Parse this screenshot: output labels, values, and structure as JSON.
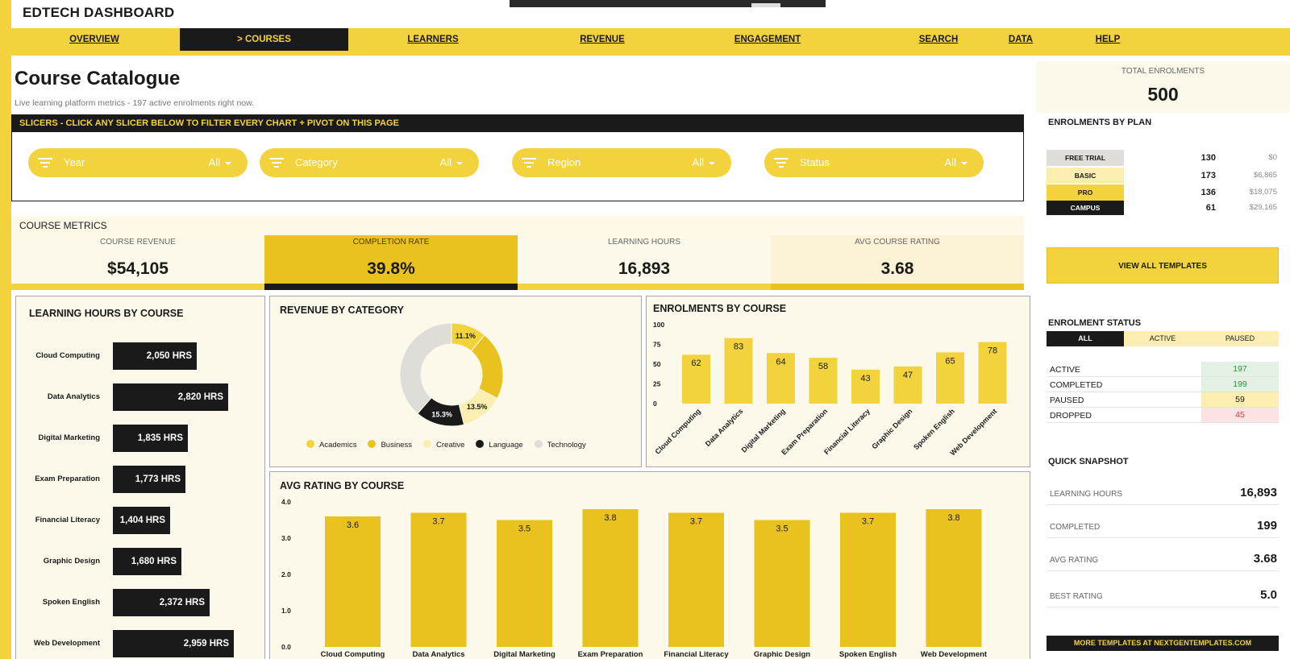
{
  "app": {
    "title": "EDTECH DASHBOARD"
  },
  "nav": {
    "items": [
      {
        "label": "OVERVIEW"
      },
      {
        "label": "> COURSES"
      },
      {
        "label": "LEARNERS"
      },
      {
        "label": "REVENUE"
      },
      {
        "label": "ENGAGEMENT"
      },
      {
        "label": "SEARCH"
      },
      {
        "label": "DATA"
      },
      {
        "label": "HELP"
      }
    ],
    "active_index": 1
  },
  "page": {
    "title": "Course Catalogue",
    "subtitle": "Live learning platform metrics  -  197 active enrolments right now."
  },
  "slicers": {
    "header": "SLICERS  -  CLICK ANY SLICER BELOW TO FILTER EVERY CHART + PIVOT ON THIS PAGE",
    "items": [
      {
        "label": "Year",
        "value": "All"
      },
      {
        "label": "Category",
        "value": "All"
      },
      {
        "label": "Region",
        "value": "All"
      },
      {
        "label": "Status",
        "value": "All"
      }
    ]
  },
  "metrics": {
    "header": "COURSE METRICS",
    "cards": [
      {
        "label": "COURSE REVENUE",
        "value": "$54,105"
      },
      {
        "label": "COMPLETION RATE",
        "value": "39.8%"
      },
      {
        "label": "LEARNING HOURS",
        "value": "16,893"
      },
      {
        "label": "AVG COURSE RATING",
        "value": "3.68"
      }
    ]
  },
  "colors": {
    "accent": "#f2d33e",
    "accent_dark": "#e9c21f",
    "dark": "#1a1a1a",
    "panel": "#fdf9ea",
    "pale": "#fbeeb0",
    "grey": "#deddd8"
  },
  "chart_data": [
    {
      "type": "bar",
      "orientation": "horizontal",
      "title": "LEARNING HOURS BY COURSE",
      "categories": [
        "Cloud Computing",
        "Data Analytics",
        "Digital Marketing",
        "Exam Preparation",
        "Financial Literacy",
        "Graphic Design",
        "Spoken English",
        "Web Development"
      ],
      "values": [
        2050,
        2820,
        1835,
        1773,
        1404,
        1680,
        2372,
        2959
      ],
      "labels": [
        "2,050 HRS",
        "2,820 HRS",
        "1,835 HRS",
        "1,773 HRS",
        "1,404 HRS",
        "1,680 HRS",
        "2,372 HRS",
        "2,959 HRS"
      ]
    },
    {
      "type": "pie",
      "title": "REVENUE BY CATEGORY",
      "categories": [
        "Academics",
        "Business",
        "Creative",
        "Language",
        "Technology"
      ],
      "values": [
        11.1,
        21.5,
        13.5,
        15.3,
        38.6
      ],
      "labels": [
        "11.1%",
        "",
        "13.5%",
        "15.3%",
        ""
      ],
      "colors": [
        "#f2d33e",
        "#e9c21f",
        "#fbeeb0",
        "#1a1a1a",
        "#deddd8"
      ]
    },
    {
      "type": "bar",
      "title": "ENROLMENTS BY COURSE",
      "categories": [
        "Cloud Computing",
        "Data Analytics",
        "Digital Marketing",
        "Exam Preparation",
        "Financial Literacy",
        "Graphic Design",
        "Spoken English",
        "Web Development"
      ],
      "values": [
        62,
        83,
        64,
        58,
        43,
        47,
        65,
        78
      ],
      "ylim": [
        0,
        100
      ],
      "yticks": [
        "0",
        "25",
        "50",
        "75",
        "100"
      ]
    },
    {
      "type": "bar",
      "title": "AVG RATING BY COURSE",
      "categories": [
        "Cloud Computing",
        "Data Analytics",
        "Digital Marketing",
        "Exam Preparation",
        "Financial Literacy",
        "Graphic Design",
        "Spoken English",
        "Web Development"
      ],
      "values": [
        3.6,
        3.7,
        3.5,
        3.8,
        3.7,
        3.5,
        3.7,
        3.8
      ],
      "ylim": [
        0,
        4
      ],
      "yticks": [
        "0.0",
        "1.0",
        "2.0",
        "3.0",
        "4.0"
      ]
    }
  ],
  "sidebar": {
    "total": {
      "label": "TOTAL ENROLMENTS",
      "value": "500"
    },
    "plans": {
      "title": "ENROLMENTS BY PLAN",
      "rows": [
        {
          "name": "FREE TRIAL",
          "count": "130",
          "revenue": "$0"
        },
        {
          "name": "BASIC",
          "count": "173",
          "revenue": "$6,865"
        },
        {
          "name": "PRO",
          "count": "136",
          "revenue": "$18,075"
        },
        {
          "name": "CAMPUS",
          "count": "61",
          "revenue": "$29,165"
        }
      ]
    },
    "templates_button": "VIEW ALL TEMPLATES",
    "status": {
      "title": "ENROLMENT STATUS",
      "tabs": [
        "ALL",
        "ACTIVE",
        "PAUSED"
      ],
      "rows": [
        {
          "label": "ACTIVE",
          "value": "197"
        },
        {
          "label": "COMPLETED",
          "value": "199"
        },
        {
          "label": "PAUSED",
          "value": "59"
        },
        {
          "label": "DROPPED",
          "value": "45"
        }
      ]
    },
    "snapshot": {
      "title": "QUICK SNAPSHOT",
      "rows": [
        {
          "label": "LEARNING HOURS",
          "value": "16,893"
        },
        {
          "label": "COMPLETED",
          "value": "199"
        },
        {
          "label": "AVG RATING",
          "value": "3.68"
        },
        {
          "label": "BEST RATING",
          "value": "5.0"
        }
      ]
    },
    "footer": "MORE TEMPLATES AT NEXTGENTEMPLATES.COM"
  }
}
